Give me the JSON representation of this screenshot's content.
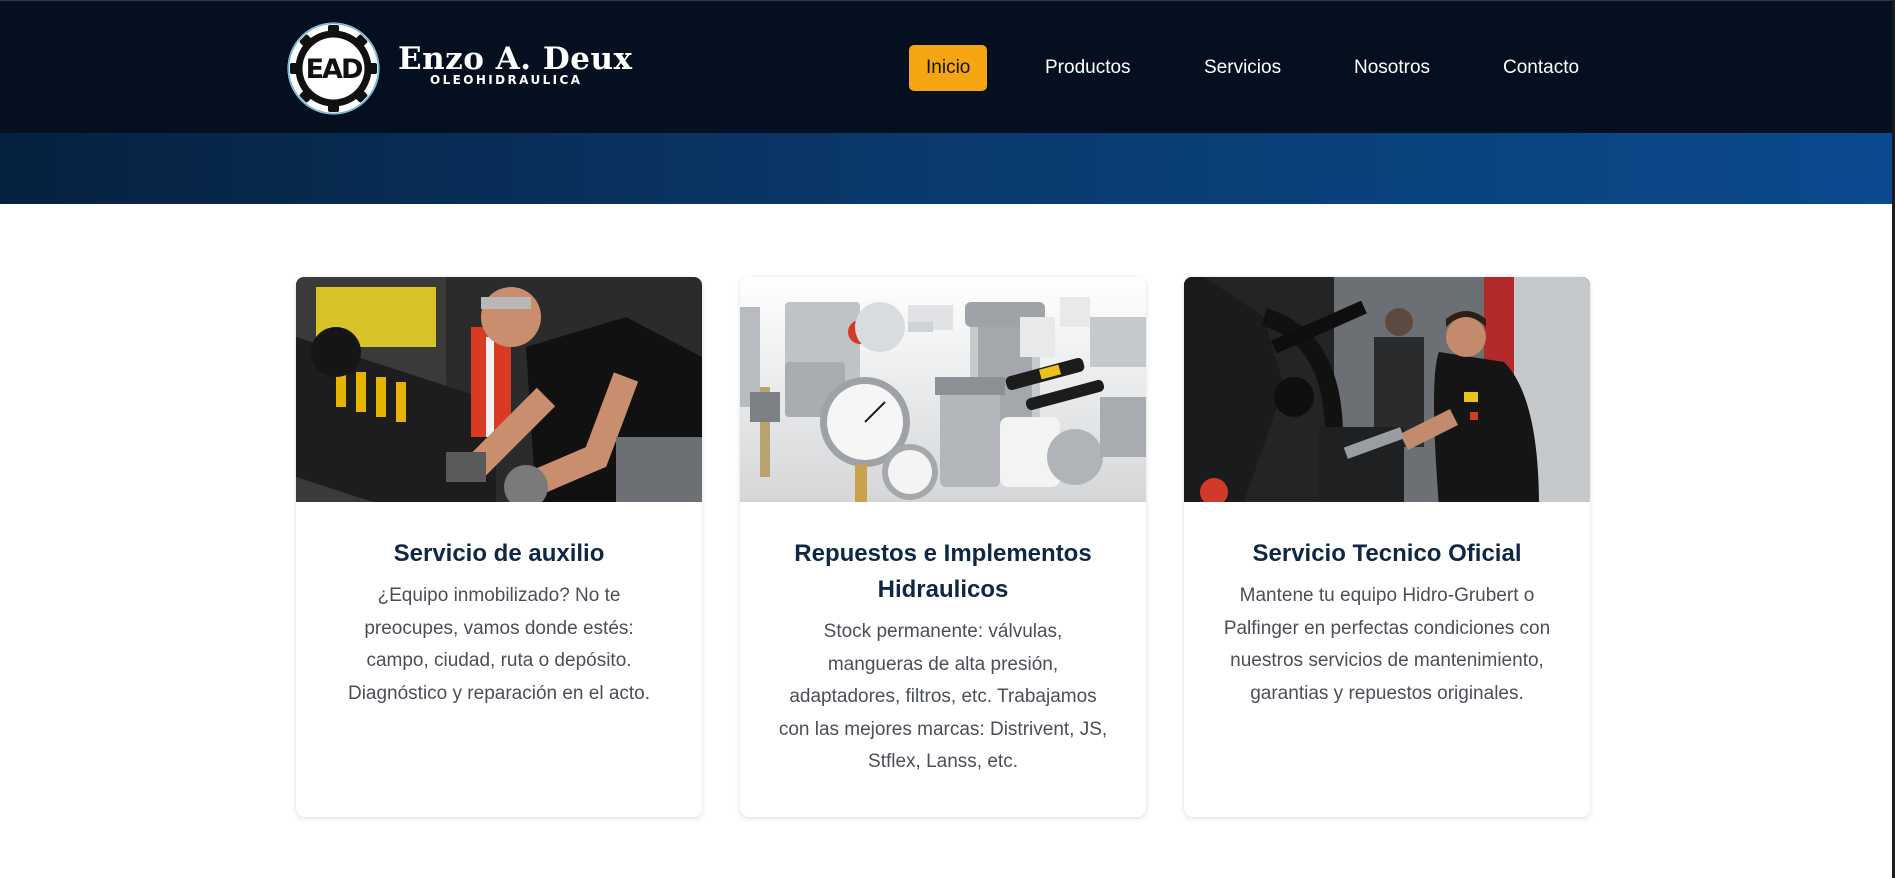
{
  "brand": {
    "logo_initials": "EAD",
    "name": "Enzo A. Deux",
    "tagline": "OLEOHIDRAULICA"
  },
  "nav": {
    "items": [
      {
        "label": "Inicio",
        "active": true
      },
      {
        "label": "Productos"
      },
      {
        "label": "Servicios"
      },
      {
        "label": "Nosotros"
      },
      {
        "label": "Contacto"
      }
    ],
    "active_color": "#f5a511"
  },
  "colors": {
    "navbar_bg": "#04101f",
    "hero_gradient_end": "#0b4a8e",
    "title": "#0f2747",
    "body_text": "#4a4f57"
  },
  "cards": [
    {
      "image": "mechanic-working-on-hydraulic-crane-photo",
      "title": "Servicio de auxilio",
      "text": "¿Equipo inmobilizado? No te preocupes, vamos donde estés: campo, ciudad, ruta o depósito. Diagnóstico y reparación en el acto."
    },
    {
      "image": "hydraulic-parts-gauges-filters-photo",
      "title": "Repuestos e Implementos Hidraulicos",
      "text": "Stock permanente: válvulas, mangueras de alta presión, adaptadores, filtros, etc. Trabajamos con las mejores marcas: Distrivent, JS, Stflex, Lanss, etc."
    },
    {
      "image": "technician-servicing-crane-photo",
      "title": "Servicio Tecnico Oficial",
      "text": "Mantene tu equipo Hidro-Grubert o Palfinger en perfectas condiciones con nuestros servicios de mantenimiento, garantias y repuestos originales."
    }
  ]
}
